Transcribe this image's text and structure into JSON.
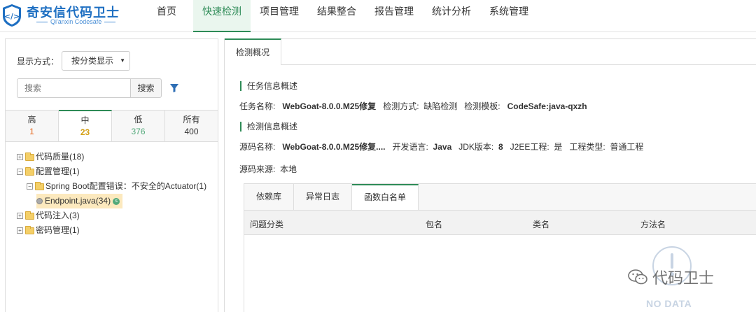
{
  "header": {
    "logo_title": "奇安信代码卫士",
    "logo_subtitle": "Qi'anxin Codesafe",
    "nav": [
      "首页",
      "快速检测",
      "项目管理",
      "结果整合",
      "报告管理",
      "统计分析",
      "系统管理"
    ],
    "active_nav": "快速检测"
  },
  "left": {
    "display_label": "显示方式：",
    "display_select": "按分类显示",
    "search_placeholder": "搜索",
    "search_button": "搜索",
    "levels": [
      {
        "name": "高",
        "count": "1"
      },
      {
        "name": "中",
        "count": "23"
      },
      {
        "name": "低",
        "count": "376"
      },
      {
        "name": "所有",
        "count": "400"
      }
    ],
    "tree": {
      "n1": "代码质量(18)",
      "n2": "配置管理(1)",
      "n2_1": "Spring Boot配置错误：不安全的Actuator(1)",
      "n2_1_1": "Endpoint.java(34)",
      "n2_1_1_badge": "s",
      "n3": "代码注入(3)",
      "n4": "密码管理(1)"
    }
  },
  "right": {
    "tab": "检测概况",
    "task_section": "任务信息概述",
    "task": {
      "name_label": "任务名称:",
      "name_value": "WebGoat-8.0.0.M25修复",
      "method_label": "检测方式:",
      "method_value": "缺陷检测",
      "template_label": "检测模板:",
      "template_value": "CodeSafe:java-qxzh"
    },
    "detect_section": "检测信息概述",
    "detect": {
      "src_label": "源码名称:",
      "src_value": "WebGoat-8.0.0.M25修复....",
      "lang_label": "开发语言:",
      "lang_value": "Java",
      "jdk_label": "JDK版本:",
      "jdk_value": "8",
      "j2ee_label": "J2EE工程:",
      "j2ee_value": "是",
      "type_label": "工程类型:",
      "type_value": "普通工程",
      "origin_label": "源码来源:",
      "origin_value": "本地"
    },
    "subtabs": [
      "依赖库",
      "异常日志",
      "函数白名单"
    ],
    "active_subtab": "函数白名单",
    "columns": [
      "问题分类",
      "包名",
      "类名",
      "方法名"
    ],
    "empty_text": "NO DATA"
  },
  "watermark": "代码卫士",
  "colors": {
    "accent": "#2e8b57",
    "logo_blue": "#1e6fc2",
    "high": "#e6671d",
    "mid": "#d4a017",
    "low": "#52a97a"
  }
}
